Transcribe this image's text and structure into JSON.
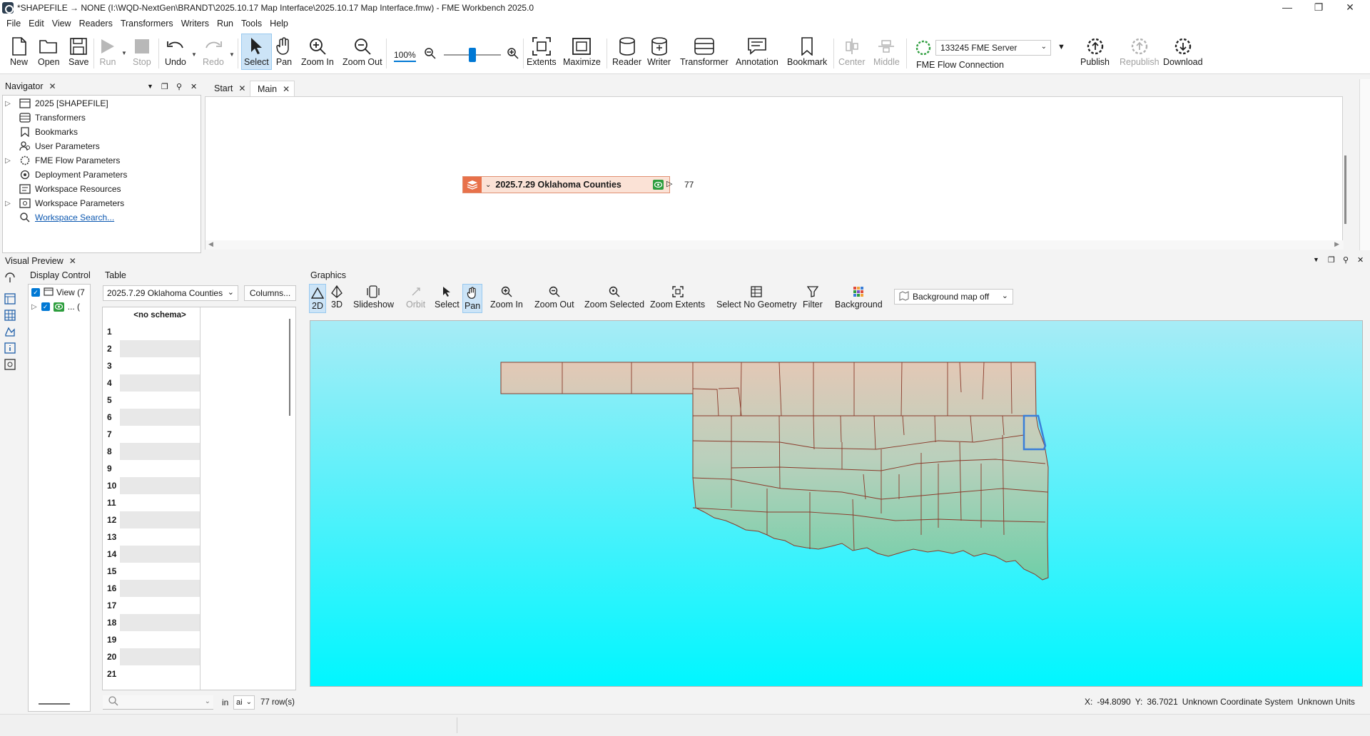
{
  "window": {
    "title": "*SHAPEFILE → NONE (I:\\WQD-NextGen\\BRANDT\\2025.10.17 Map Interface\\2025.10.17 Map Interface.fmw) - FME Workbench 2025.0"
  },
  "menu": [
    "File",
    "Edit",
    "View",
    "Readers",
    "Transformers",
    "Writers",
    "Run",
    "Tools",
    "Help"
  ],
  "toolbar": {
    "new": "New",
    "open": "Open",
    "save": "Save",
    "run": "Run",
    "stop": "Stop",
    "undo": "Undo",
    "redo": "Redo",
    "select": "Select",
    "pan": "Pan",
    "zoom_in": "Zoom In",
    "zoom_out": "Zoom Out",
    "zoom_level": "100%",
    "extents": "Extents",
    "maximize": "Maximize",
    "reader": "Reader",
    "writer": "Writer",
    "transformer": "Transformer",
    "annotation": "Annotation",
    "bookmark": "Bookmark",
    "center": "Center",
    "middle": "Middle",
    "server_name": "133245 FME Server",
    "flow_connection": "FME Flow Connection",
    "publish": "Publish",
    "republish": "Republish",
    "download": "Download"
  },
  "navigator": {
    "title": "Navigator",
    "items": [
      {
        "label": "2025 [SHAPEFILE]",
        "expandable": true,
        "icon": "dataset-icon"
      },
      {
        "label": "Transformers",
        "expandable": false,
        "icon": "transformers-icon"
      },
      {
        "label": "Bookmarks",
        "expandable": false,
        "icon": "bookmark-icon"
      },
      {
        "label": "User Parameters",
        "expandable": false,
        "icon": "user-parameters-icon"
      },
      {
        "label": "FME Flow Parameters",
        "expandable": true,
        "icon": "flow-parameters-icon"
      },
      {
        "label": "Deployment Parameters",
        "expandable": false,
        "icon": "deployment-icon"
      },
      {
        "label": "Workspace Resources",
        "expandable": false,
        "icon": "resources-icon"
      },
      {
        "label": "Workspace Parameters",
        "expandable": true,
        "icon": "workspace-parameters-icon"
      },
      {
        "label": "Workspace Search...",
        "expandable": false,
        "icon": "search-icon",
        "link": true
      }
    ]
  },
  "canvas": {
    "tabs": [
      "Start",
      "Main"
    ],
    "feature_type": "2025.7.29 Oklahoma Counties",
    "feature_count": "77"
  },
  "visual_preview": {
    "title": "Visual Preview",
    "display_control": {
      "title": "Display Control",
      "view_label": "View (7",
      "layer_label": "... ("
    },
    "table": {
      "title": "Table",
      "selected_layer": "2025.7.29 Oklahoma Counties",
      "columns_button": "Columns...",
      "header": "<no schema>",
      "rows": [
        "1",
        "2",
        "3",
        "4",
        "5",
        "6",
        "7",
        "8",
        "9",
        "10",
        "11",
        "12",
        "13",
        "14",
        "15",
        "16",
        "17",
        "18",
        "19",
        "20",
        "21"
      ],
      "search_in": "in",
      "search_scope": "ai",
      "row_count": "77 row(s)"
    },
    "graphics": {
      "title": "Graphics",
      "buttons": {
        "2d": "2D",
        "3d": "3D",
        "slideshow": "Slideshow",
        "orbit": "Orbit",
        "select": "Select",
        "pan": "Pan",
        "zoom_in": "Zoom In",
        "zoom_out": "Zoom Out",
        "zoom_selected": "Zoom Selected",
        "zoom_extents": "Zoom Extents",
        "select_no_geometry": "Select No Geometry",
        "filter": "Filter",
        "background": "Background"
      },
      "background_map": "Background map off"
    },
    "status": {
      "x_label": "X:",
      "x_value": "-94.8090",
      "y_label": "Y:",
      "y_value": "36.7021",
      "coord_system": "Unknown Coordinate System",
      "units": "Unknown Units"
    }
  },
  "colors": {
    "accent": "#0078d4",
    "selected_bg": "#cce4f7",
    "feature_fill": "#fbe2d6",
    "county_border": "#8a3a2a",
    "selection_outline": "#3a7fd8"
  }
}
